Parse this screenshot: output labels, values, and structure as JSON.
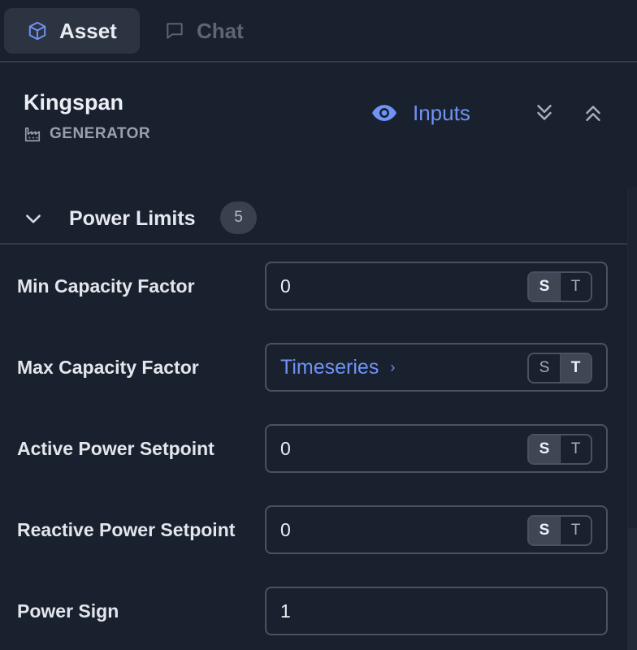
{
  "tabs": [
    {
      "label": "Asset",
      "icon": "cube-icon",
      "active": true
    },
    {
      "label": "Chat",
      "icon": "chat-bubble-icon",
      "active": false
    }
  ],
  "asset": {
    "name": "Kingspan",
    "type": "GENERATOR",
    "type_icon": "factory-icon"
  },
  "header_actions": {
    "inputs_label": "Inputs",
    "inputs_icon": "eye-icon",
    "expand_all_icon": "chevrons-down-icon",
    "collapse_all_icon": "chevrons-up-icon"
  },
  "section": {
    "title": "Power Limits",
    "count": "5"
  },
  "rows": [
    {
      "label": "Min Capacity Factor",
      "value": "0",
      "mode": "S",
      "toggle": [
        "S",
        "T"
      ]
    },
    {
      "label": "Max Capacity Factor",
      "value": "Timeseries",
      "mode": "T",
      "toggle": [
        "S",
        "T"
      ]
    },
    {
      "label": "Active Power Setpoint",
      "value": "0",
      "mode": "S",
      "toggle": [
        "S",
        "T"
      ]
    },
    {
      "label": "Reactive Power Setpoint",
      "value": "0",
      "mode": "S",
      "toggle": [
        "S",
        "T"
      ]
    },
    {
      "label": "Power Sign",
      "value": "1"
    }
  ],
  "colors": {
    "background": "#19202e",
    "accent": "#6f93f7",
    "border": "#4a5261"
  }
}
